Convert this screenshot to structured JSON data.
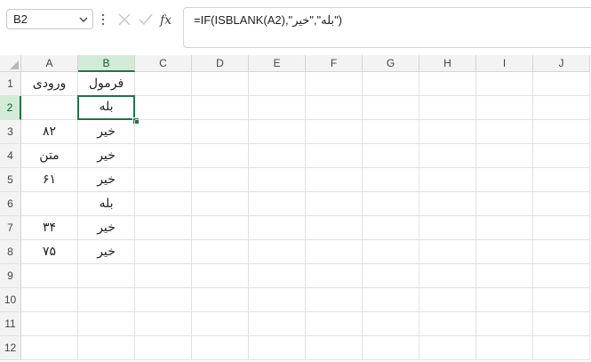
{
  "namebox": {
    "value": "B2"
  },
  "formula_bar": {
    "text": "=IF(ISBLANK(A2),\"بله\",\"خیر\")"
  },
  "columns": [
    "A",
    "B",
    "C",
    "D",
    "E",
    "F",
    "G",
    "H",
    "I",
    "J"
  ],
  "rows": [
    "1",
    "2",
    "3",
    "4",
    "5",
    "6",
    "7",
    "8",
    "9",
    "10",
    "11",
    "12"
  ],
  "cells": {
    "A1": "ورودی",
    "B1": "فرمول",
    "A2": "",
    "B2": "بله",
    "A3": "۸۲",
    "B3": "خیر",
    "A4": "متن",
    "B4": "خیر",
    "A5": "۶۱",
    "B5": "خیر",
    "A6": "",
    "B6": "بله",
    "A7": "۳۴",
    "B7": "خیر",
    "A8": "۷۵",
    "B8": "خیر"
  },
  "selection": {
    "cell": "B2",
    "column": "B",
    "row": "2"
  },
  "colors": {
    "accent": "#217346",
    "header_bg": "#f3f3f3",
    "selected_header_bg": "#d2ebd6"
  },
  "icons": [
    "chevron-down-icon",
    "more-vertical-icon",
    "cancel-icon",
    "confirm-check-icon",
    "function-fx-icon",
    "select-all-triangle-icon"
  ]
}
